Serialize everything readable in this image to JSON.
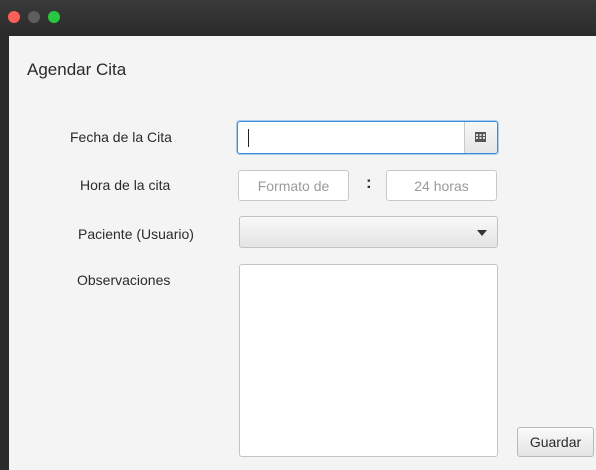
{
  "window": {
    "controls": [
      "close",
      "minimize",
      "maximize"
    ]
  },
  "form": {
    "title": "Agendar Cita",
    "date_label": "Fecha de la Cita",
    "date_value": "",
    "time_label": "Hora de la cita",
    "hour_placeholder": "Formato de",
    "time_separator": ":",
    "minute_placeholder": "24 horas",
    "patient_label": "Paciente (Usuario)",
    "patient_selected": "",
    "notes_label": "Observaciones",
    "notes_value": "",
    "save_label": "Guardar"
  },
  "icons": {
    "calendar": "calendar-icon",
    "dropdown": "chevron-down-icon"
  },
  "colors": {
    "focus_border": "#3d8ed8",
    "titlebar": "#2f2f2f",
    "close": "#fe5f57",
    "maximize": "#28c840"
  }
}
